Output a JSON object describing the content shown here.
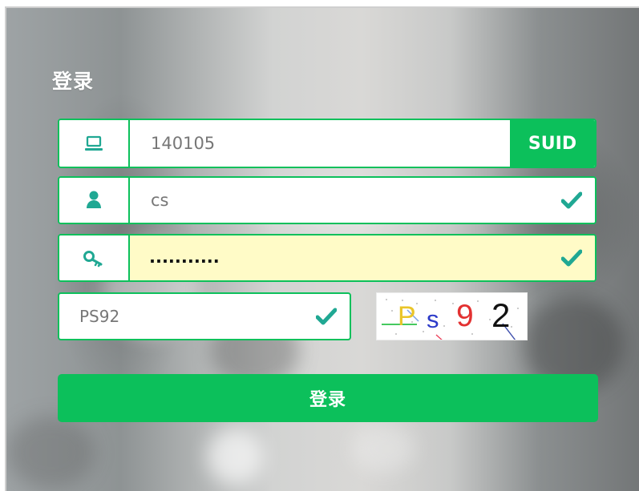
{
  "login": {
    "title": "登录",
    "suid_label": "SUID",
    "suid_value": "140105",
    "username_value": "cs",
    "password_value": "...........",
    "captcha_value": "PS92",
    "captcha_image_text": {
      "p": "P",
      "s": "s",
      "nine": "9",
      "two": "2"
    },
    "submit_label": "登录"
  },
  "icons": {
    "suid": "laptop-icon",
    "username": "user-icon",
    "password": "key-icon",
    "valid": "check-icon"
  },
  "colors": {
    "accent": "#0cc05b",
    "icon_teal": "#20a893",
    "password_fill": "#fffbc7",
    "placeholder_gray": "#777777"
  }
}
